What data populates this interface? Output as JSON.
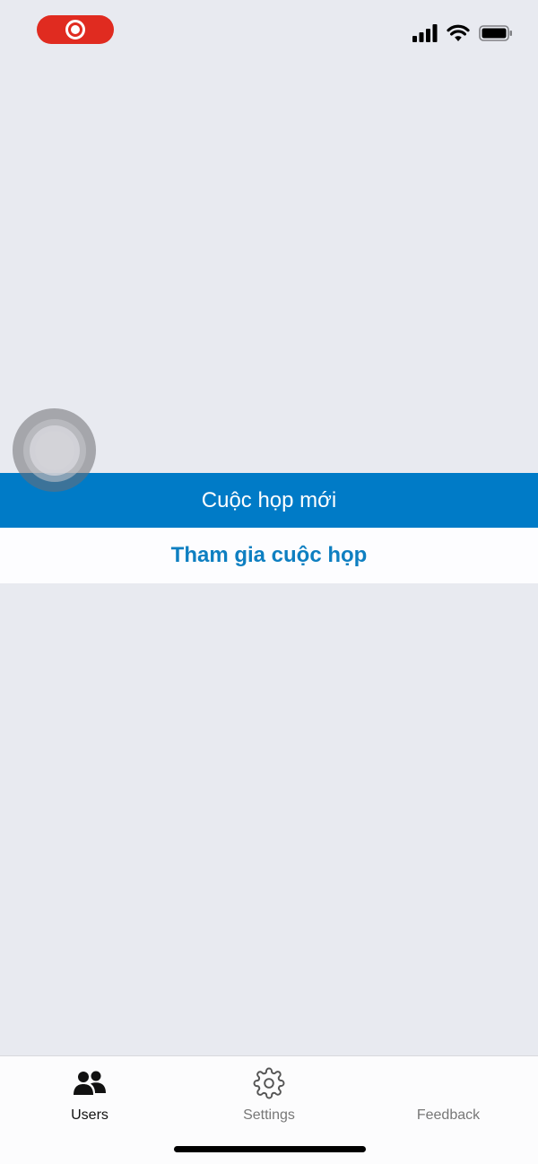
{
  "status_bar": {
    "recording_indicator": "record-icon",
    "icons": [
      "cellular-signal-icon",
      "wifi-icon",
      "battery-icon"
    ]
  },
  "main": {
    "new_meeting_label": "Cuộc họp mới",
    "join_meeting_label": "Tham gia cuộc họp"
  },
  "tab_bar": {
    "tabs": [
      {
        "label": "Users",
        "icon": "users-icon",
        "active": true
      },
      {
        "label": "Settings",
        "icon": "gear-icon",
        "active": false
      },
      {
        "label": "Feedback",
        "icon": "",
        "active": false
      }
    ]
  },
  "colors": {
    "background": "#e8eaf0",
    "primary": "#007bc7",
    "recording": "#e02b20"
  }
}
